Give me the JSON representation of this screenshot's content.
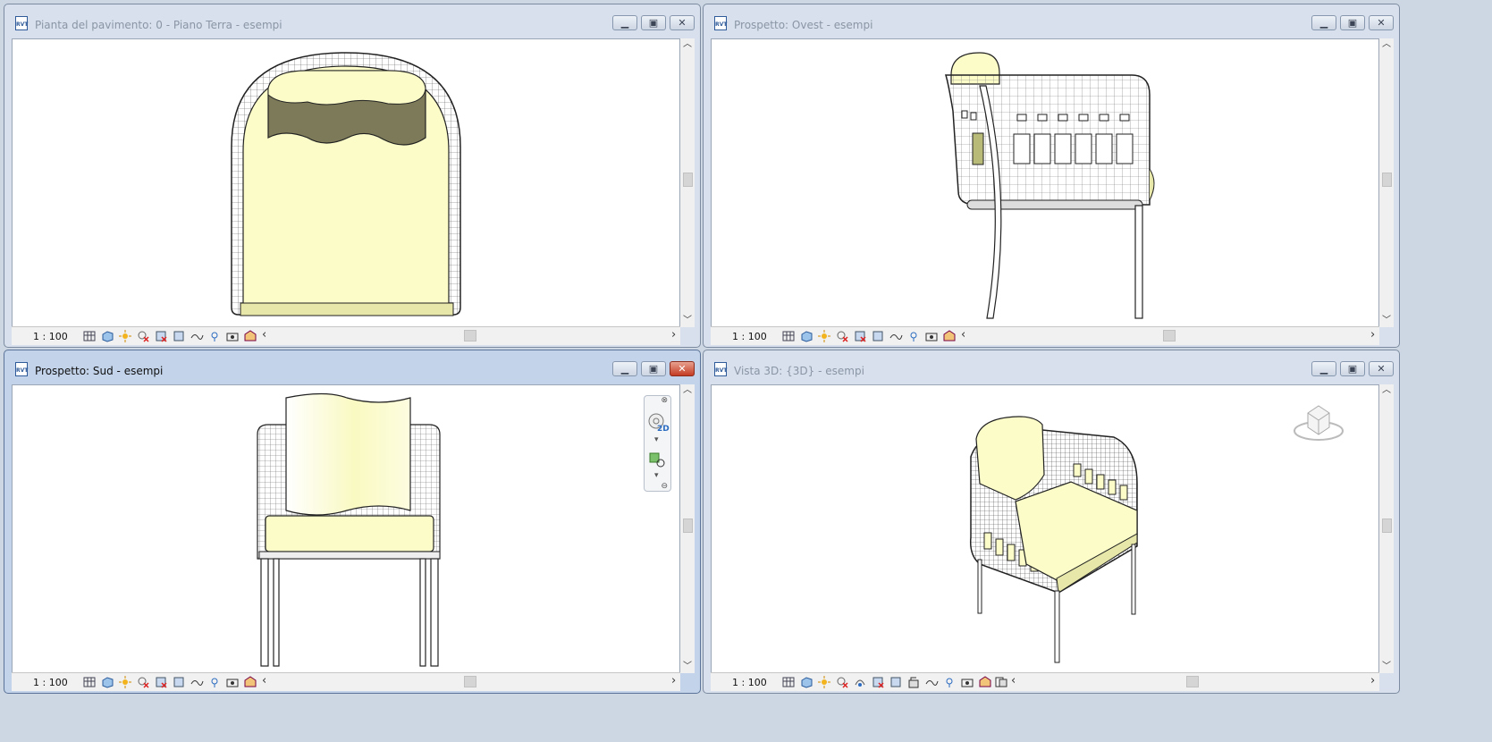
{
  "windows": [
    {
      "title": "Pianta del pavimento: 0 - Piano Terra - esempi",
      "scale": "1 : 100",
      "active": false
    },
    {
      "title": "Prospetto: Ovest - esempi",
      "scale": "1 : 100",
      "active": false
    },
    {
      "title": "Prospetto: Sud - esempi",
      "scale": "1 : 100",
      "active": true
    },
    {
      "title": "Vista 3D: {3D} - esempi",
      "scale": "1 : 100",
      "active": false
    }
  ],
  "app_icon_label": "RVT",
  "window_buttons": {
    "minimize": "▁",
    "restore": "▣",
    "close": "✕"
  },
  "scroll_arrows": {
    "up": "︿",
    "down": "﹀",
    "left": "‹",
    "right": "›"
  },
  "view_controls": [
    "detail-level-icon",
    "visual-style-icon",
    "sun-path-icon",
    "shadows-icon",
    "crop-view-icon",
    "show-crop-icon",
    "temporary-hide-icon",
    "reveal-hidden-icon",
    "lock-3d-icon",
    "analytical-model-icon",
    "highlight-displacement-icon"
  ],
  "navbar_label": "2D",
  "colors": {
    "cushion": "#fbfcc8",
    "cushion_shadow": "#7c7a58",
    "frame": "#2b2b2b",
    "window_bg": "#d7e0ec",
    "active_window_bg": "#c2d3ea",
    "close_active": "#c43b22"
  }
}
